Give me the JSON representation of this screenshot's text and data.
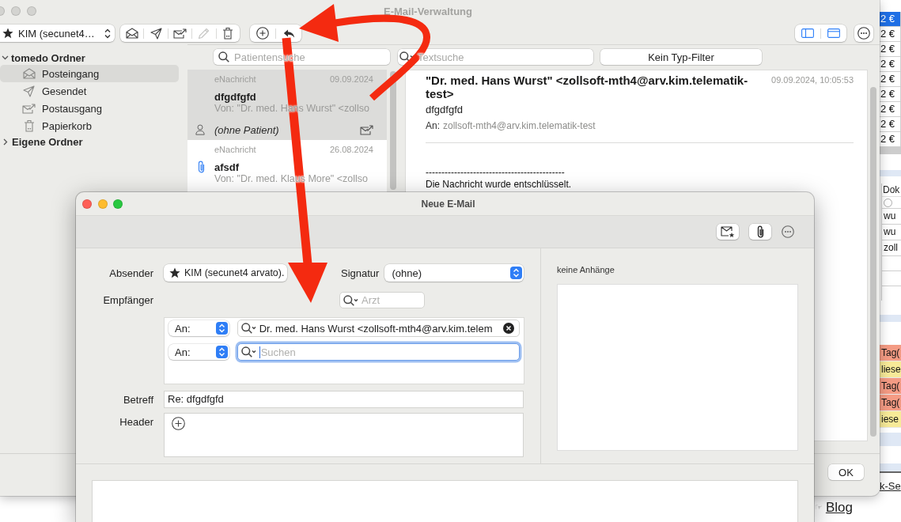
{
  "main_window": {
    "title": "E-Mail-Verwaltung",
    "active": false,
    "account": "KIM (secunet4…",
    "mail_tools": [
      {
        "disabled": false
      },
      {
        "disabled": false
      },
      {
        "disabled": false
      },
      {
        "disabled": true
      },
      {
        "disabled": false
      }
    ],
    "sidebar": [
      {
        "title": "tomedo Ordner",
        "expanded": true,
        "children": [
          {
            "label": "Posteingang",
            "selected": true
          },
          {
            "label": "Gesendet",
            "selected": false
          },
          {
            "label": "Postausgang",
            "selected": false
          },
          {
            "label": "Papierkorb",
            "selected": false
          }
        ]
      },
      {
        "title": "Eigene Ordner",
        "expanded": false
      }
    ],
    "patient_search": {
      "placeholder": "Patientensuche"
    },
    "text_search": {
      "placeholder": "Textsuche"
    },
    "type_filter": "Kein Typ-Filter",
    "messages": [
      {
        "type": "eNachricht",
        "date": "09.09.2024",
        "subject": "dfgdfgfd",
        "from": "Von: \"Dr. med. Hans Wurst\" <zollso",
        "patient": "(ohne Patient)",
        "attachment": false,
        "selected": true
      },
      {
        "type": "eNachricht",
        "date": "26.08.2024",
        "subject": "afsdf",
        "from": "Von: \"Dr. med. Klaus More\" <zollso",
        "attachment": true,
        "selected": false
      }
    ],
    "reading_pane": {
      "from": "\"Dr. med. Hans Wurst\" <zollsoft-mth4@arv.kim.telematik-test>",
      "date": "09.09.2024, 10:05:53",
      "subject": "dfgdfgfd",
      "to_label": "An:",
      "to": "zollsoft-mth4@arv.kim.telematik-test",
      "body": [
        "--------------------------------------------",
        "Die Nachricht wurde entschlüsselt."
      ]
    },
    "ok_button": "OK"
  },
  "compose_window": {
    "title": "Neue E-Mail",
    "active": true,
    "sender_label": "Absender",
    "sender": "KIM (secunet4 arvato).",
    "signature_label": "Signatur",
    "signature": "(ohne)",
    "recipients_label": "Empfänger",
    "doctor_search": {
      "placeholder": "Arzt"
    },
    "recipients": [
      {
        "type": "An:",
        "value": "Dr. med. Hans Wurst <zollsoft-mth4@arv.kim.telem",
        "focused": false
      },
      {
        "type": "An:",
        "placeholder": "Suchen",
        "focused": true
      }
    ],
    "subject_label": "Betreff",
    "subject": "Re: dfgdfgfd",
    "header_label": "Header",
    "attachments_label": "keine Anhänge"
  },
  "background": {
    "amount_cells": [
      {
        "text": "2 €",
        "selected": true
      },
      {
        "text": "2 €",
        "selected": false
      },
      {
        "text": "2 €",
        "selected": false
      },
      {
        "text": "2 €",
        "selected": false
      },
      {
        "text": "2 €",
        "selected": false
      },
      {
        "text": "2 €",
        "selected": false
      },
      {
        "text": "2 €",
        "selected": false
      },
      {
        "text": "2 €",
        "selected": false
      },
      {
        "text": "2 €",
        "selected": false
      }
    ],
    "column_header": "Dok",
    "cells": [
      "wu",
      "wu",
      "zoll"
    ],
    "tag_cells": [
      {
        "text": "Tag(",
        "color": "#f49b84"
      },
      {
        "text": "liese",
        "color": "#f7ea98"
      },
      {
        "text": "Tag(",
        "color": "#f49b84"
      },
      {
        "text": "Tag(",
        "color": "#f49b84"
      },
      {
        "text": "iese",
        "color": "#f7ea98"
      }
    ],
    "links": [
      {
        "text": "k-Se"
      },
      {
        "icon": "☞",
        "text": "Blog"
      }
    ]
  }
}
